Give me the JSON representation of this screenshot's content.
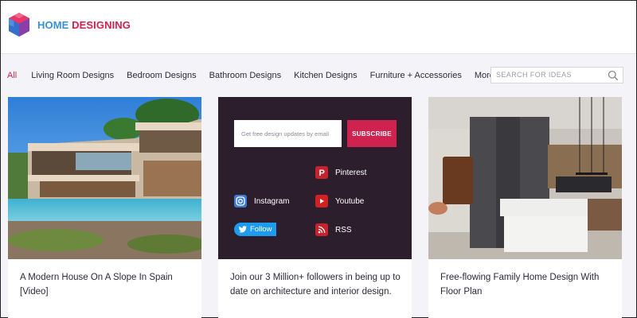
{
  "logo": {
    "word1": "HOME",
    "word2": "DESIGNING"
  },
  "nav": {
    "items": [
      {
        "label": "All",
        "active": true
      },
      {
        "label": "Living Room Designs"
      },
      {
        "label": "Bedroom Designs"
      },
      {
        "label": "Bathroom Designs"
      },
      {
        "label": "Kitchen Designs"
      },
      {
        "label": "Furniture + Accessories"
      },
      {
        "label": "More"
      }
    ]
  },
  "search": {
    "placeholder": "SEARCH FOR IDEAS",
    "icon": "search-icon"
  },
  "cards": [
    {
      "title": "A Modern House On A Slope In Spain [Video]"
    },
    {
      "title": "Join our 3 Million+ followers in being up to date on architecture and interior design."
    },
    {
      "title": "Free-flowing Family Home Design With Floor Plan"
    }
  ],
  "subscribe": {
    "placeholder": "Get free design updates by email",
    "button": "SUBSCRIBE"
  },
  "social": {
    "pinterest": "Pinterest",
    "instagram": "Instagram",
    "youtube": "Youtube",
    "rss": "RSS",
    "follow": "Follow"
  },
  "colors": {
    "brand": "#d0224e",
    "accent": "#3a8fd6",
    "panel": "#2d1e2e"
  }
}
